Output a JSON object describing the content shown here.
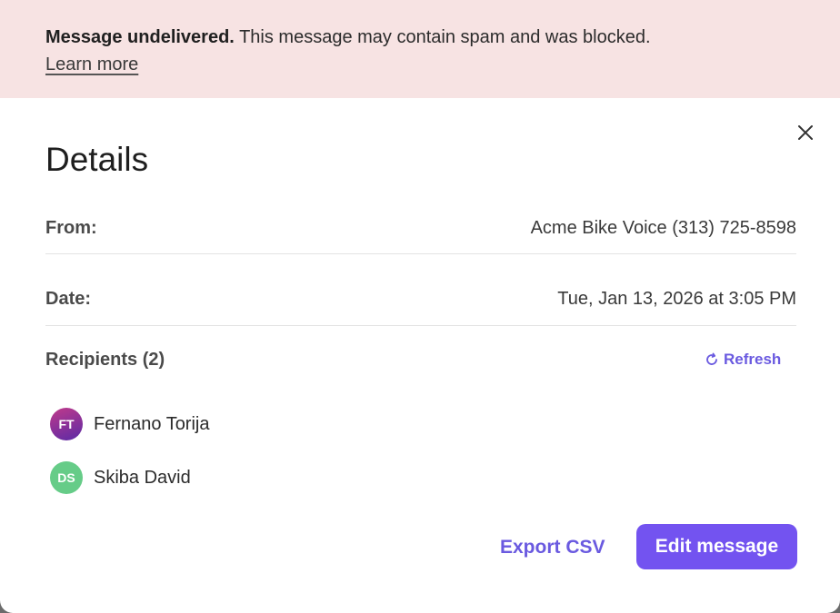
{
  "banner": {
    "title": "Message undelivered.",
    "text": " This message may contain spam and was blocked.",
    "learn_more": "Learn more"
  },
  "dialog": {
    "title": "Details",
    "close_icon": "close-icon"
  },
  "details": {
    "from_label": "From:",
    "from_value": "Acme Bike Voice (313) 725-8598",
    "date_label": "Date:",
    "date_value": "Tue, Jan 13, 2026 at 3:05 PM"
  },
  "recipients": {
    "label": "Recipients (2)",
    "refresh_label": "Refresh",
    "refresh_icon": "refresh-icon",
    "items": [
      {
        "initials": "FT",
        "name": "Fernano Torija",
        "color": "#7a2f9e"
      },
      {
        "initials": "DS",
        "name": "Skiba David",
        "color": "#66cc88"
      }
    ]
  },
  "actions": {
    "export_label": "Export CSV",
    "edit_label": "Edit message"
  },
  "colors": {
    "accent": "#7353f0",
    "banner_bg": "#f7e3e3"
  }
}
